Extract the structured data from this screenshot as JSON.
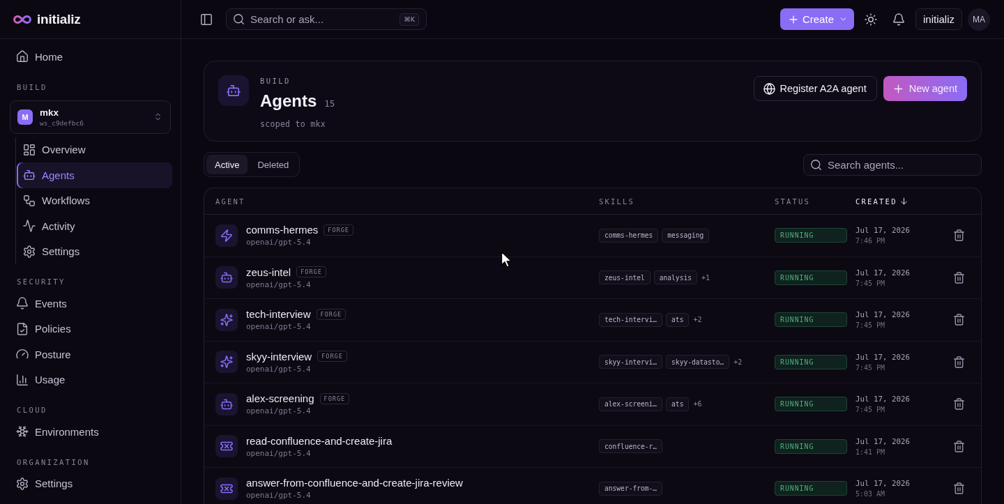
{
  "sidebar": {
    "logo": "initializ",
    "sections": [
      {
        "items": [
          {
            "label": "Home",
            "kind": "home",
            "selected": false
          }
        ]
      },
      {
        "title": "BUILD",
        "workspace": {
          "initial": "M",
          "name": "mkx",
          "id": "ws_c9defbc6"
        },
        "items": [
          {
            "label": "Overview",
            "kind": "grid",
            "selected": false
          },
          {
            "label": "Agents",
            "kind": "robot",
            "selected": true
          },
          {
            "label": "Workflows",
            "kind": "workflow",
            "selected": false
          },
          {
            "label": "Activity",
            "kind": "activity",
            "selected": false
          },
          {
            "label": "Settings",
            "kind": "gear",
            "selected": false
          }
        ]
      },
      {
        "title": "SECURITY",
        "items": [
          {
            "label": "Events",
            "kind": "bell",
            "selected": false
          },
          {
            "label": "Policies",
            "kind": "file-check",
            "selected": false
          },
          {
            "label": "Posture",
            "kind": "gauge",
            "selected": false
          },
          {
            "label": "Usage",
            "kind": "chart",
            "selected": false
          }
        ]
      },
      {
        "title": "CLOUD",
        "items": [
          {
            "label": "Environments",
            "kind": "snowflake",
            "selected": false
          }
        ]
      },
      {
        "title": "ORGANIZATION",
        "items": [
          {
            "label": "Settings",
            "kind": "gear",
            "selected": false
          }
        ]
      }
    ]
  },
  "top_bar": {
    "search": {
      "placeholder": "Search or ask...",
      "shortcut": "⌘K"
    },
    "create_button": "Create",
    "workspace_button": "initializ",
    "avatar": "MA"
  },
  "page_header": {
    "eyebrow": "BUILD",
    "title": "Agents",
    "count": "15",
    "subtitle": "scoped to mkx",
    "buttons": [
      {
        "label": "Register A2A agent",
        "kind": "outline"
      },
      {
        "label": "New agent",
        "kind": "primary"
      }
    ]
  },
  "tabs": [
    {
      "label": "Active",
      "selected": true
    },
    {
      "label": "Deleted",
      "selected": false
    }
  ],
  "search": {
    "placeholder": "Search agents..."
  },
  "table": {
    "columns": [
      {
        "label": "AGENT",
        "sorted": false
      },
      {
        "label": "SKILLS",
        "sorted": false
      },
      {
        "label": "STATUS",
        "sorted": false
      },
      {
        "label": "CREATED",
        "sorted": true
      }
    ],
    "rows": [
      {
        "name": "comms-hermes",
        "badge": "FORGE",
        "model": "openai/gpt-5.4",
        "kind": "bolt",
        "skills": [
          {
            "label": "comms-hermes",
            "kind": "tag"
          },
          {
            "label": "messaging",
            "kind": "tag"
          }
        ],
        "status": "RUNNING",
        "date": "Jul 17, 2026",
        "time": "7:46 PM"
      },
      {
        "name": "zeus-intel",
        "badge": "FORGE",
        "model": "openai/gpt-5.4",
        "kind": "robot",
        "skills": [
          {
            "label": "zeus-intel",
            "kind": "tag"
          },
          {
            "label": "analysis",
            "kind": "tag"
          },
          {
            "label": "+1",
            "kind": "more"
          }
        ],
        "status": "RUNNING",
        "date": "Jul 17, 2026",
        "time": "7:45 PM"
      },
      {
        "name": "tech-interview",
        "badge": "FORGE",
        "model": "openai/gpt-5.4",
        "kind": "sparkles",
        "skills": [
          {
            "label": "tech-intervi…",
            "kind": "tag"
          },
          {
            "label": "ats",
            "kind": "tag"
          },
          {
            "label": "+2",
            "kind": "more"
          }
        ],
        "status": "RUNNING",
        "date": "Jul 17, 2026",
        "time": "7:45 PM"
      },
      {
        "name": "skyy-interview",
        "badge": "FORGE",
        "model": "openai/gpt-5.4",
        "kind": "sparkles",
        "skills": [
          {
            "label": "skyy-intervi…",
            "kind": "tag"
          },
          {
            "label": "skyy-datasto…",
            "kind": "tag"
          },
          {
            "label": "+2",
            "kind": "more"
          }
        ],
        "status": "RUNNING",
        "date": "Jul 17, 2026",
        "time": "7:45 PM"
      },
      {
        "name": "alex-screening",
        "badge": "FORGE",
        "model": "openai/gpt-5.4",
        "kind": "robot",
        "skills": [
          {
            "label": "alex-screeni…",
            "kind": "tag"
          },
          {
            "label": "ats",
            "kind": "tag"
          },
          {
            "label": "+6",
            "kind": "more"
          }
        ],
        "status": "RUNNING",
        "date": "Jul 17, 2026",
        "time": "7:45 PM"
      },
      {
        "name": "read-confluence-and-create-jira",
        "model": "openai/gpt-5.4",
        "kind": "ticket",
        "skills": [
          {
            "label": "confluence-r…",
            "kind": "tag"
          }
        ],
        "status": "RUNNING",
        "date": "Jul 17, 2026",
        "time": "1:41 PM"
      },
      {
        "name": "answer-from-confluence-and-create-jira-review",
        "model": "openai/gpt-5.4",
        "kind": "ticket",
        "skills": [
          {
            "label": "answer-from-…",
            "kind": "tag"
          }
        ],
        "status": "RUNNING",
        "date": "Jul 17, 2026",
        "time": "5:03 AM"
      }
    ]
  }
}
